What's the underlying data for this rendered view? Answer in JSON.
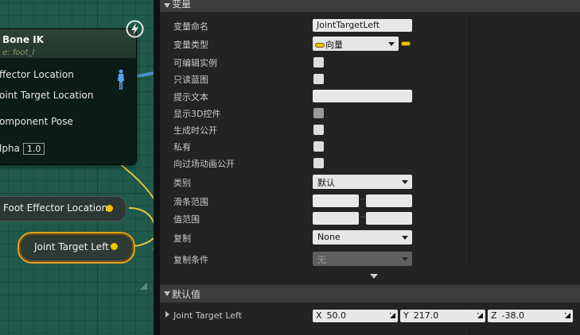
{
  "graph": {
    "node": {
      "title": "Bone IK",
      "subtitle": "e: foot_l",
      "pins": [
        "ffector Location",
        "oint Target Location",
        "omponent Pose",
        "lpha"
      ],
      "alpha_value": "1.0"
    },
    "variable_nodes": [
      {
        "label": "Foot Effector Location"
      },
      {
        "label": "Joint Target Left"
      }
    ],
    "colors": {
      "pin": "#f2c200",
      "wire": "#e2c541",
      "selected_border": "#e0a020",
      "exec_wire": "#4a8fc9"
    }
  },
  "details": {
    "variable_section": {
      "title": "变量"
    },
    "properties": {
      "name_label": "变量命名",
      "name_value": "JointTargetLeft",
      "type_label": "变量类型",
      "type_value": "向量",
      "instance_editable": "可编辑实例",
      "blueprint_readonly": "只读蓝图",
      "tooltip": "提示文本",
      "show_3d_widget": "显示3D控件",
      "expose_on_spawn": "生成时公开",
      "private": "私有",
      "expose_to_cinematics": "向过场动画公开",
      "category_label": "类别",
      "category_value": "默认",
      "slider_range": "滑条范围",
      "value_range": "值范围",
      "replication_label": "复制",
      "replication_value": "None",
      "replication_condition_label": "复制条件",
      "replication_condition_value": "无"
    },
    "default_section": {
      "title": "默认值"
    },
    "default_value": {
      "label": "Joint Target Left",
      "x_key": "X",
      "x": "50.0",
      "y_key": "Y",
      "y": "217.0",
      "z_key": "Z",
      "z": "-38.0"
    }
  }
}
